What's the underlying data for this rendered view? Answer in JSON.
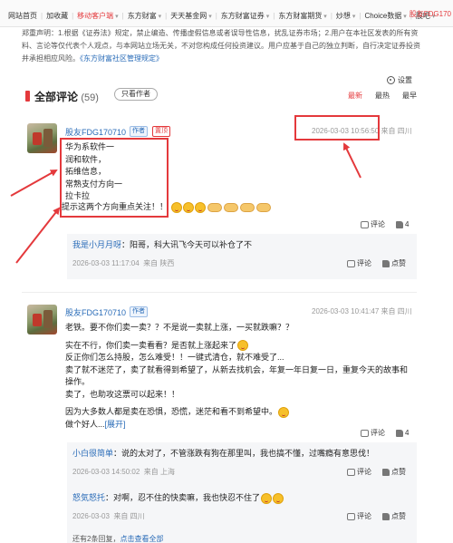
{
  "topnav": {
    "links": [
      "网站首页",
      "加收藏",
      "移动客户端",
      "东方财富",
      "天天基金网",
      "东方财富证券",
      "东方财富期货",
      "炒想",
      "Choice数据",
      "股吧"
    ],
    "right": "股友FDG170"
  },
  "disclaimer": {
    "line1": "郑重声明：1.根据《证券法》规定，禁止编造、传播虚假信息或者误导性信息，扰乱证券市场；2.用户在本社区发表的所有资",
    "line2": "料、言论等仅代表个人观点，与本网站立场无关，不对您构成任何投资建议。用户应基于自己的独立判断，自行决定证券投资",
    "line3_a": "并承担相应风险。",
    "line3_link": "《东方财富社区管理规定》"
  },
  "settings_label": "设置",
  "comments": {
    "title": "全部评论",
    "count": "(59)",
    "author_only": "只看作者",
    "sorts": [
      "最新",
      "最热",
      "最早"
    ]
  },
  "post1": {
    "user": "股友FDG170710",
    "author_tag": "作者",
    "top_tag": "置顶",
    "time": "2026-03-03 10:56:50",
    "from": "来自 四川",
    "lines": [
      "华为系软件一",
      "润和软件，",
      "拓维信息，",
      "常熟支付方向一",
      "拉卡拉",
      "提示这两个方向重点关注！！"
    ],
    "reply_label": "评论",
    "likes": "4"
  },
  "reply1": {
    "name": "我是小月月呀",
    "text": "：阳哥，科大讯飞今天可以补仓了不",
    "time": "2026-03-03 11:17:04",
    "from": "来自 陕西",
    "comment_label": "评论",
    "like_label": "点赞"
  },
  "post2": {
    "user": "股友FDG170710",
    "author_tag": "作者",
    "time": "2026-03-03 10:41:47",
    "from": "来自 四川",
    "lines": [
      "老铁。要不你们卖一卖？？不是说一卖就上涨，一买就跌嘛？？",
      "实在不行，你们卖一卖看看？是否就上涨起来了",
      "反正你们怎么持股，怎么难受！！一键式清仓，就不难受了...",
      "卖了就不迷茫了，卖了就看得到希望了，从新去找机会，年复一年日复一日，重复今天的故事和",
      "操作。",
      "卖了，也助攻这票可以起来！！",
      "因为大多数人都是卖在恐惧，恐慌，迷茫和看不到希望中。",
      "做个好人..."
    ],
    "expand": "[展开]",
    "reply_label": "评论",
    "likes": "4"
  },
  "reply2": {
    "name": "小白很简单",
    "text": "：说的太对了，不管涨跌有狗在那里叫，我也搞不懂，过嘴瘾有意思伐！",
    "time": "2026-03-03 14:50:02",
    "from": "来自 上海",
    "comment_label": "评论",
    "like_label": "点赞"
  },
  "reply3": {
    "name": "怒気怒托",
    "text": "：对啊，忍不住的快卖嘛，我也快忍不住了",
    "time": "2026-03-03",
    "from": "来自 四川",
    "comment_label": "评论",
    "like_label": "点赞"
  },
  "more_replies": {
    "text": "还有2条回复，",
    "link": "点击查看全部"
  },
  "colors": {
    "accent": "#e4393c",
    "link": "#2a6cb8"
  }
}
